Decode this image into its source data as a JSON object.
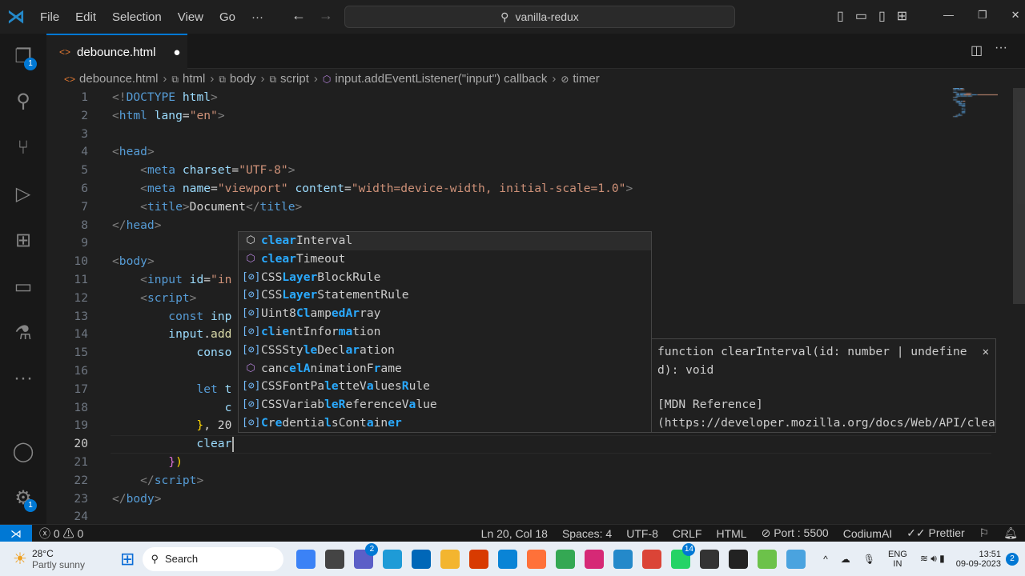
{
  "titlebar": {
    "menus": [
      "File",
      "Edit",
      "Selection",
      "View",
      "Go",
      "···"
    ],
    "search": "vanilla-redux"
  },
  "activity": {
    "explorer_badge": "1",
    "settings_badge": "1"
  },
  "tab": {
    "filename": "debounce.html",
    "dirty": "●"
  },
  "breadcrumb": [
    "debounce.html",
    "html",
    "body",
    "script",
    "input.addEventListener(\"input\") callback",
    "timer"
  ],
  "code": {
    "lines": [
      [
        [
          "<!",
          "g"
        ],
        [
          "DOCTYPE",
          "t"
        ],
        [
          " html",
          "a"
        ],
        [
          ">",
          "g"
        ]
      ],
      [
        [
          "<",
          "g"
        ],
        [
          "html",
          "t"
        ],
        [
          " lang",
          "a"
        ],
        [
          "=",
          "x"
        ],
        [
          "\"en\"",
          "s"
        ],
        [
          ">",
          "g"
        ]
      ],
      [],
      [
        [
          "<",
          "g"
        ],
        [
          "head",
          "t"
        ],
        [
          ">",
          "g"
        ]
      ],
      [
        [
          "    <",
          "g"
        ],
        [
          "meta",
          "t"
        ],
        [
          " charset",
          "a"
        ],
        [
          "=",
          "x"
        ],
        [
          "\"UTF-8\"",
          "s"
        ],
        [
          ">",
          "g"
        ]
      ],
      [
        [
          "    <",
          "g"
        ],
        [
          "meta",
          "t"
        ],
        [
          " name",
          "a"
        ],
        [
          "=",
          "x"
        ],
        [
          "\"viewport\"",
          "s"
        ],
        [
          " content",
          "a"
        ],
        [
          "=",
          "x"
        ],
        [
          "\"width=device-width, initial-scale=1.0\"",
          "s"
        ],
        [
          ">",
          "g"
        ]
      ],
      [
        [
          "    <",
          "g"
        ],
        [
          "title",
          "t"
        ],
        [
          ">",
          "g"
        ],
        [
          "Document",
          "x"
        ],
        [
          "</",
          "g"
        ],
        [
          "title",
          "t"
        ],
        [
          ">",
          "g"
        ]
      ],
      [
        [
          "</",
          "g"
        ],
        [
          "head",
          "t"
        ],
        [
          ">",
          "g"
        ]
      ],
      [],
      [
        [
          "<",
          "g"
        ],
        [
          "body",
          "t"
        ],
        [
          ">",
          "g"
        ]
      ],
      [
        [
          "    <",
          "g"
        ],
        [
          "input",
          "t"
        ],
        [
          " id",
          "a"
        ],
        [
          "=",
          "x"
        ],
        [
          "\"in",
          "s"
        ]
      ],
      [
        [
          "    <",
          "g"
        ],
        [
          "script",
          "t"
        ],
        [
          ">",
          "g"
        ]
      ],
      [
        [
          "        const",
          "k"
        ],
        [
          " inp",
          "v"
        ]
      ],
      [
        [
          "        input",
          "v"
        ],
        [
          ".",
          "x"
        ],
        [
          "add",
          "f"
        ]
      ],
      [
        [
          "            conso",
          "v"
        ]
      ],
      [],
      [
        [
          "            let",
          "k"
        ],
        [
          " t",
          "v"
        ]
      ],
      [
        [
          "                c",
          "v"
        ]
      ],
      [
        [
          "            }",
          "y"
        ],
        [
          ", 20",
          "x"
        ]
      ],
      [
        [
          "            clear",
          "v"
        ]
      ],
      [
        [
          "        }",
          "p"
        ],
        [
          ")",
          "y"
        ]
      ],
      [
        [
          "    </",
          "g"
        ],
        [
          "script",
          "t"
        ],
        [
          ">",
          "g"
        ]
      ],
      [
        [
          "</",
          "g"
        ],
        [
          "body",
          "t"
        ],
        [
          ">",
          "g"
        ]
      ],
      []
    ],
    "current_line": 20
  },
  "suggest": {
    "items": [
      {
        "kind": "method",
        "parts": [
          [
            "clear",
            1
          ],
          [
            "Interval",
            0
          ]
        ]
      },
      {
        "kind": "method",
        "parts": [
          [
            "clear",
            1
          ],
          [
            "Timeout",
            0
          ]
        ]
      },
      {
        "kind": "variable",
        "parts": [
          [
            "CSS",
            0
          ],
          [
            "Layer",
            1
          ],
          [
            "BlockRule",
            0
          ]
        ]
      },
      {
        "kind": "variable",
        "parts": [
          [
            "CSS",
            0
          ],
          [
            "Layer",
            1
          ],
          [
            "StatementRule",
            0
          ]
        ]
      },
      {
        "kind": "variable",
        "parts": [
          [
            "Uint8",
            0
          ],
          [
            "Cl",
            1
          ],
          [
            "amp",
            0
          ],
          [
            "ed",
            1
          ],
          [
            "A",
            1
          ],
          [
            "r",
            1
          ],
          [
            "ray",
            0
          ]
        ]
      },
      {
        "kind": "variable",
        "parts": [
          [
            "cl",
            1
          ],
          [
            "i",
            0
          ],
          [
            "e",
            1
          ],
          [
            "ntInfor",
            0
          ],
          [
            "ma",
            1
          ],
          [
            "tion",
            0
          ]
        ]
      },
      {
        "kind": "variable",
        "parts": [
          [
            "CSSSty",
            0
          ],
          [
            "le",
            1
          ],
          [
            "Decl",
            0
          ],
          [
            "ar",
            1
          ],
          [
            "ation",
            0
          ]
        ]
      },
      {
        "kind": "method",
        "parts": [
          [
            "canc",
            0
          ],
          [
            "el",
            1
          ],
          [
            "A",
            1
          ],
          [
            "nimationF",
            0
          ],
          [
            "r",
            1
          ],
          [
            "ame",
            0
          ]
        ]
      },
      {
        "kind": "variable",
        "parts": [
          [
            "CSSFontPa",
            0
          ],
          [
            "le",
            1
          ],
          [
            "tteV",
            0
          ],
          [
            "a",
            1
          ],
          [
            "lues",
            0
          ],
          [
            "R",
            1
          ],
          [
            "ule",
            0
          ]
        ]
      },
      {
        "kind": "variable",
        "parts": [
          [
            "CSSVariab",
            0
          ],
          [
            "le",
            1
          ],
          [
            "R",
            1
          ],
          [
            "eferenceV",
            0
          ],
          [
            "a",
            1
          ],
          [
            "lue",
            0
          ]
        ]
      },
      {
        "kind": "variable",
        "parts": [
          [
            "C",
            1
          ],
          [
            "r",
            0
          ],
          [
            "e",
            1
          ],
          [
            "dentia",
            0
          ],
          [
            "l",
            1
          ],
          [
            "sCont",
            0
          ],
          [
            "a",
            1
          ],
          [
            "in",
            0
          ],
          [
            "er",
            1
          ]
        ]
      }
    ]
  },
  "details": {
    "signature": "function clearInterval(id: number | undefined): void",
    "mdn": "[MDN Reference]",
    "link": "(https://developer.mozilla.org/docs/Web/API/clearInterva",
    "close": "✕"
  },
  "status": {
    "errors": "0",
    "warnings": "0",
    "position": "Ln 20, Col 18",
    "spaces": "Spaces: 4",
    "encoding": "UTF-8",
    "eol": "CRLF",
    "language": "HTML",
    "port": "Port : 5500",
    "codium": "CodiumAI",
    "prettier": "Prettier"
  },
  "taskbar": {
    "temp": "28°C",
    "weather": "Partly sunny",
    "search": "Search",
    "lang1": "ENG",
    "lang2": "IN",
    "time": "13:51",
    "date": "09-09-2023",
    "notif": "2",
    "teams_badge": "2",
    "whatsapp_badge": "14"
  },
  "colors": {
    "accent": "#0078d4",
    "match": "#2aaaff",
    "method": "#b180d7",
    "variable": "#75beff"
  }
}
